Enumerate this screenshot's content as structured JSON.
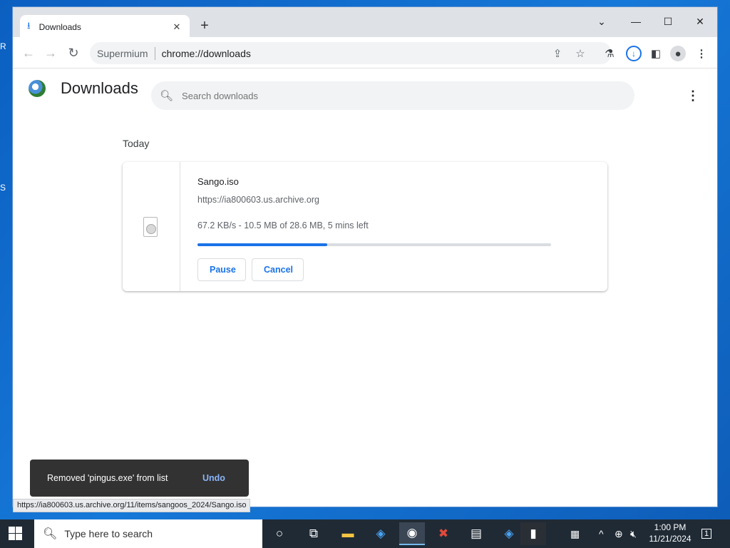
{
  "browser": {
    "tab_title": "Downloads",
    "brand": "Supermium",
    "url": "chrome://downloads",
    "status_url": "https://ia800603.us.archive.org/11/items/sangoos_2024/Sango.iso"
  },
  "downloads_page": {
    "title": "Downloads",
    "search_placeholder": "Search downloads",
    "date_heading": "Today",
    "item": {
      "filename": "Sango.iso",
      "source_url": "https://ia800603.us.archive.org",
      "status": "67.2 KB/s - 10.5 MB of 28.6 MB, 5 mins left",
      "progress_percent": 36.7,
      "pause_label": "Pause",
      "cancel_label": "Cancel"
    }
  },
  "toast": {
    "message": "Removed 'pingus.exe' from list",
    "undo_label": "Undo"
  },
  "taskbar": {
    "search_placeholder": "Type here to search",
    "time": "1:00 PM",
    "date": "11/21/2024",
    "notification_count": "1"
  },
  "colors": {
    "accent": "#1a73e8",
    "taskbar": "#1f2a35",
    "desktop": "#0b5fc0"
  }
}
